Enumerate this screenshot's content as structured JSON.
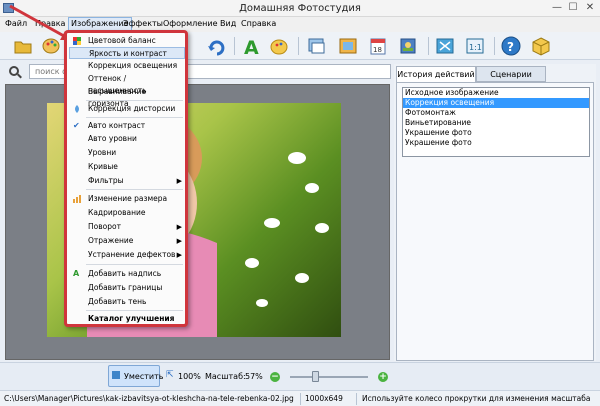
{
  "window": {
    "title": "Домашняя Фотостудия",
    "minimize": "—",
    "maximize": "☐",
    "close": "✕"
  },
  "menubar": {
    "items": [
      "Файл",
      "Правка",
      "Изображение",
      "Эффекты",
      "Оформление",
      "Вид",
      "Справка"
    ],
    "active": "Изображение"
  },
  "search": {
    "placeholder": "поиск фото"
  },
  "image_menu": {
    "items": [
      {
        "label": "Цветовой баланс",
        "icon": "color-balance-icon"
      },
      {
        "label": "Яркость и контраст",
        "highlighted": true
      },
      {
        "label": "Коррекция освещения"
      },
      {
        "label": "Оттенок / насыщенность"
      },
      {
        "label": "Выравнивание горизонта"
      },
      {
        "label": "Коррекция дисторсии",
        "icon": "distortion-icon"
      },
      {
        "label": "Авто контраст",
        "icon": "checkmark-icon"
      },
      {
        "label": "Авто уровни"
      },
      {
        "label": "Уровни"
      },
      {
        "label": "Кривые"
      },
      {
        "label": "Фильтры",
        "submenu": true
      },
      {
        "label": "Изменение размера",
        "icon": "resize-icon"
      },
      {
        "label": "Кадрирование"
      },
      {
        "label": "Поворот",
        "submenu": true
      },
      {
        "label": "Отражение",
        "submenu": true
      },
      {
        "label": "Устранение дефектов",
        "submenu": true
      },
      {
        "label": "Добавить надпись",
        "icon": "text-icon"
      },
      {
        "label": "Добавить границы"
      },
      {
        "label": "Добавить тень"
      },
      {
        "label": "Каталог улучшения",
        "bold": true
      }
    ]
  },
  "panel": {
    "tabs": [
      "История действий",
      "Сценарии"
    ],
    "history": [
      "Исходное изображение",
      "Коррекция освещения",
      "Фотомонтаж",
      "Виньетирование",
      "Украшение фото",
      "Украшение фото"
    ],
    "selected_index": 1
  },
  "bottom": {
    "fit_label": "Уместить",
    "actual_label": "100%",
    "zoom_label": "Масштаб:",
    "zoom_value": "57%",
    "zoom_minus": "−",
    "zoom_plus": "+"
  },
  "status": {
    "path": "C:\\Users\\Manager\\Pictures\\kak-izbavitsya-ot-kleshcha-na-tele-rebenka-02.jpg",
    "dimensions": "1000x649",
    "hint": "Используйте колесо прокрутки для изменения масштаба"
  },
  "colors": {
    "accent": "#d0353c",
    "selection": "#3399ff",
    "menu_highlight": "#dce8f7"
  }
}
